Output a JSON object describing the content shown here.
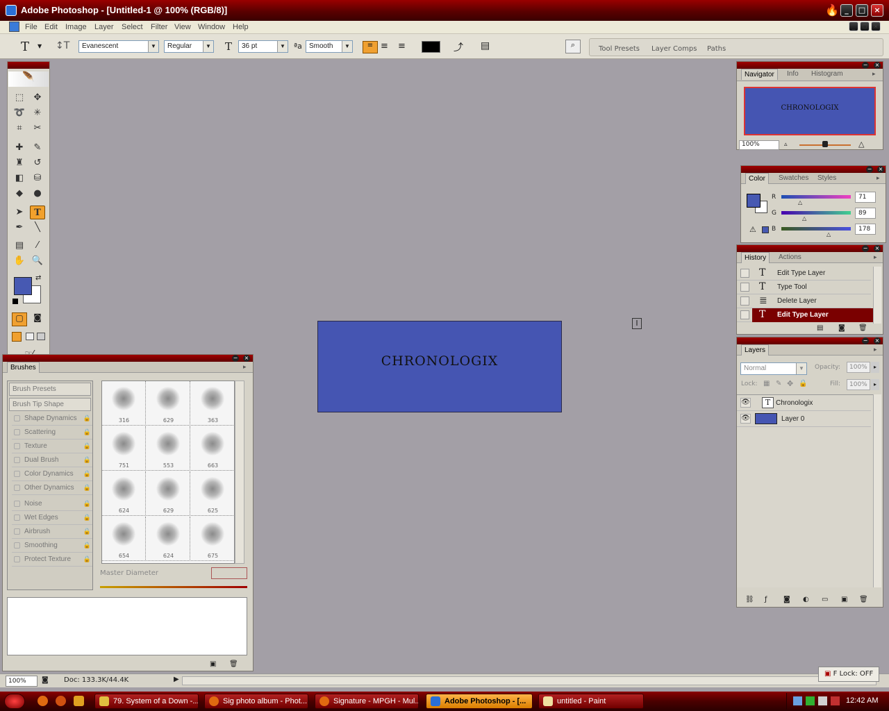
{
  "window": {
    "title": "Adobe Photoshop - [Untitled-1 @ 100% (RGB/8)]"
  },
  "menu": [
    "File",
    "Edit",
    "Image",
    "Layer",
    "Select",
    "Filter",
    "View",
    "Window",
    "Help"
  ],
  "options": {
    "font_family": "Evanescent",
    "font_style": "Regular",
    "font_size": "36 pt",
    "antialias": "Smooth",
    "text_color": "#000000",
    "wells": [
      "Tool Presets",
      "Layer Comps",
      "Paths"
    ]
  },
  "toolbox": {
    "foreground": "#4759b2",
    "background": "#ffffff"
  },
  "canvas": {
    "text": "CHRONOLOGIX",
    "fill": "#4555b2"
  },
  "navigator": {
    "tabs": [
      "Navigator",
      "Info",
      "Histogram"
    ],
    "preview_text": "CHRONOLOGIX",
    "zoom": "100%"
  },
  "color": {
    "tabs": [
      "Color",
      "Swatches",
      "Styles"
    ],
    "R": {
      "label": "R",
      "value": "71"
    },
    "G": {
      "label": "G",
      "value": "89"
    },
    "B": {
      "label": "B",
      "value": "178"
    }
  },
  "history": {
    "tabs": [
      "History",
      "Actions"
    ],
    "items": [
      {
        "icon": "T",
        "label": "Edit Type Layer"
      },
      {
        "icon": "T",
        "label": "Type Tool"
      },
      {
        "icon": "≣",
        "label": "Delete Layer"
      },
      {
        "icon": "T",
        "label": "Edit Type Layer",
        "selected": true
      }
    ]
  },
  "layers": {
    "tab": "Layers",
    "blend": "Normal",
    "opacity_label": "Opacity:",
    "opacity": "100%",
    "lock_label": "Lock:",
    "fill_label": "Fill:",
    "fill": "100%",
    "items": [
      {
        "name": "Chronologix",
        "type": "text"
      },
      {
        "name": "Layer 0",
        "type": "fill"
      }
    ]
  },
  "brushes": {
    "tab": "Brushes",
    "presets_label": "Brush Presets",
    "tip_label": "Brush Tip Shape",
    "options": [
      "Shape Dynamics",
      "Scattering",
      "Texture",
      "Dual Brush",
      "Color Dynamics",
      "Other Dynamics",
      "Noise",
      "Wet Edges",
      "Airbrush",
      "Smoothing",
      "Protect Texture"
    ],
    "sizes": [
      "316",
      "629",
      "363",
      "751",
      "553",
      "663",
      "624",
      "629",
      "625",
      "654",
      "624",
      "675"
    ],
    "master_label": "Master Diameter"
  },
  "status": {
    "zoom": "100%",
    "doc": "Doc: 133.3K/44.4K"
  },
  "flock": "F Lock: OFF",
  "taskbar": {
    "items": [
      "79. System of a Down -...",
      "Sig photo album - Phot...",
      "Signature - MPGH - Mul...",
      "Adobe Photoshop - [...",
      "untitled - Paint"
    ],
    "active": 3,
    "clock": "12:42 AM"
  }
}
